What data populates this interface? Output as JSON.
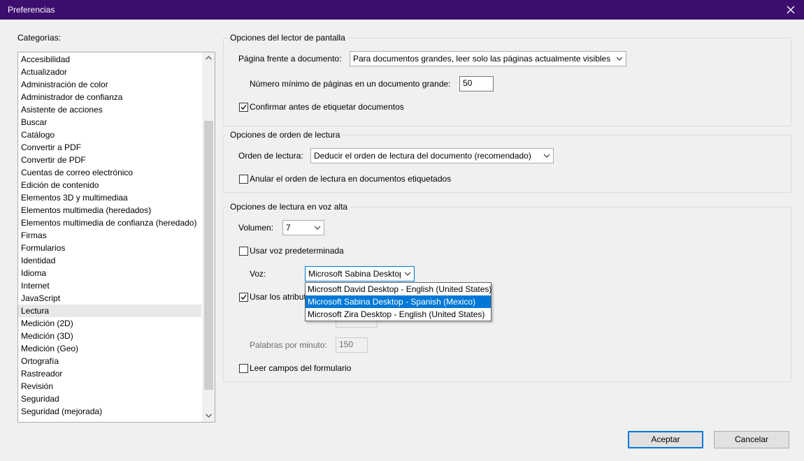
{
  "window": {
    "title": "Preferencias",
    "close_icon": "close-icon"
  },
  "categories": {
    "label": "Categorías:",
    "selected": "Lectura",
    "items": [
      "Accesibilidad",
      "Actualizador",
      "Administración de color",
      "Administrador de confianza",
      "Asistente de acciones",
      "Buscar",
      "Catálogo",
      "Convertir a PDF",
      "Convertir de PDF",
      "Cuentas de correo electrónico",
      "Edición de contenido",
      "Elementos 3D y multimediaa",
      "Elementos multimedia (heredados)",
      "Elementos multimedia de confianza (heredado)",
      "Firmas",
      "Formularios",
      "Identidad",
      "Idioma",
      "Internet",
      "JavaScript",
      "Lectura",
      "Medición (2D)",
      "Medición (3D)",
      "Medición (Geo)",
      "Ortografía",
      "Rastreador",
      "Revisión",
      "Seguridad",
      "Seguridad (mejorada)"
    ]
  },
  "screen_reader": {
    "legend": "Opciones del lector de pantalla",
    "page_vs_doc_label": "Página frente a documento:",
    "page_vs_doc_value": "Para documentos grandes, leer solo las páginas actualmente visibles",
    "min_pages_label": "Número mínimo de páginas en un documento grande:",
    "min_pages_value": "50",
    "confirm_tag_label": "Confirmar antes de etiquetar documentos",
    "confirm_tag_checked": true
  },
  "reading_order": {
    "legend": "Opciones de orden de lectura",
    "order_label": "Orden de lectura:",
    "order_value": "Deducir el orden de lectura del documento (recomendado)",
    "override_label": "Anular el orden de lectura en documentos etiquetados",
    "override_checked": false
  },
  "read_aloud": {
    "legend": "Opciones de lectura en voz alta",
    "volume_label": "Volumen:",
    "volume_value": "7",
    "default_voice_label": "Usar voz predeterminada",
    "default_voice_checked": false,
    "voice_label": "Voz:",
    "voice_value": "Microsoft Sabina Desktop",
    "voice_options": [
      "Microsoft David Desktop - English (United States)",
      "Microsoft Sabina Desktop - Spanish (Mexico)",
      "Microsoft Zira Desktop - English (United States)"
    ],
    "voice_highlighted_index": 1,
    "attrs_label": "Usar los atribut",
    "attrs_checked": true,
    "wpm_label": "Palabras por minuto:",
    "wpm_value": "150",
    "form_fields_label": "Leer campos del formulario",
    "form_fields_checked": false
  },
  "buttons": {
    "ok": "Aceptar",
    "cancel": "Cancelar"
  },
  "colors": {
    "titlebar": "#3c0f6e",
    "accent": "#0078d7"
  }
}
